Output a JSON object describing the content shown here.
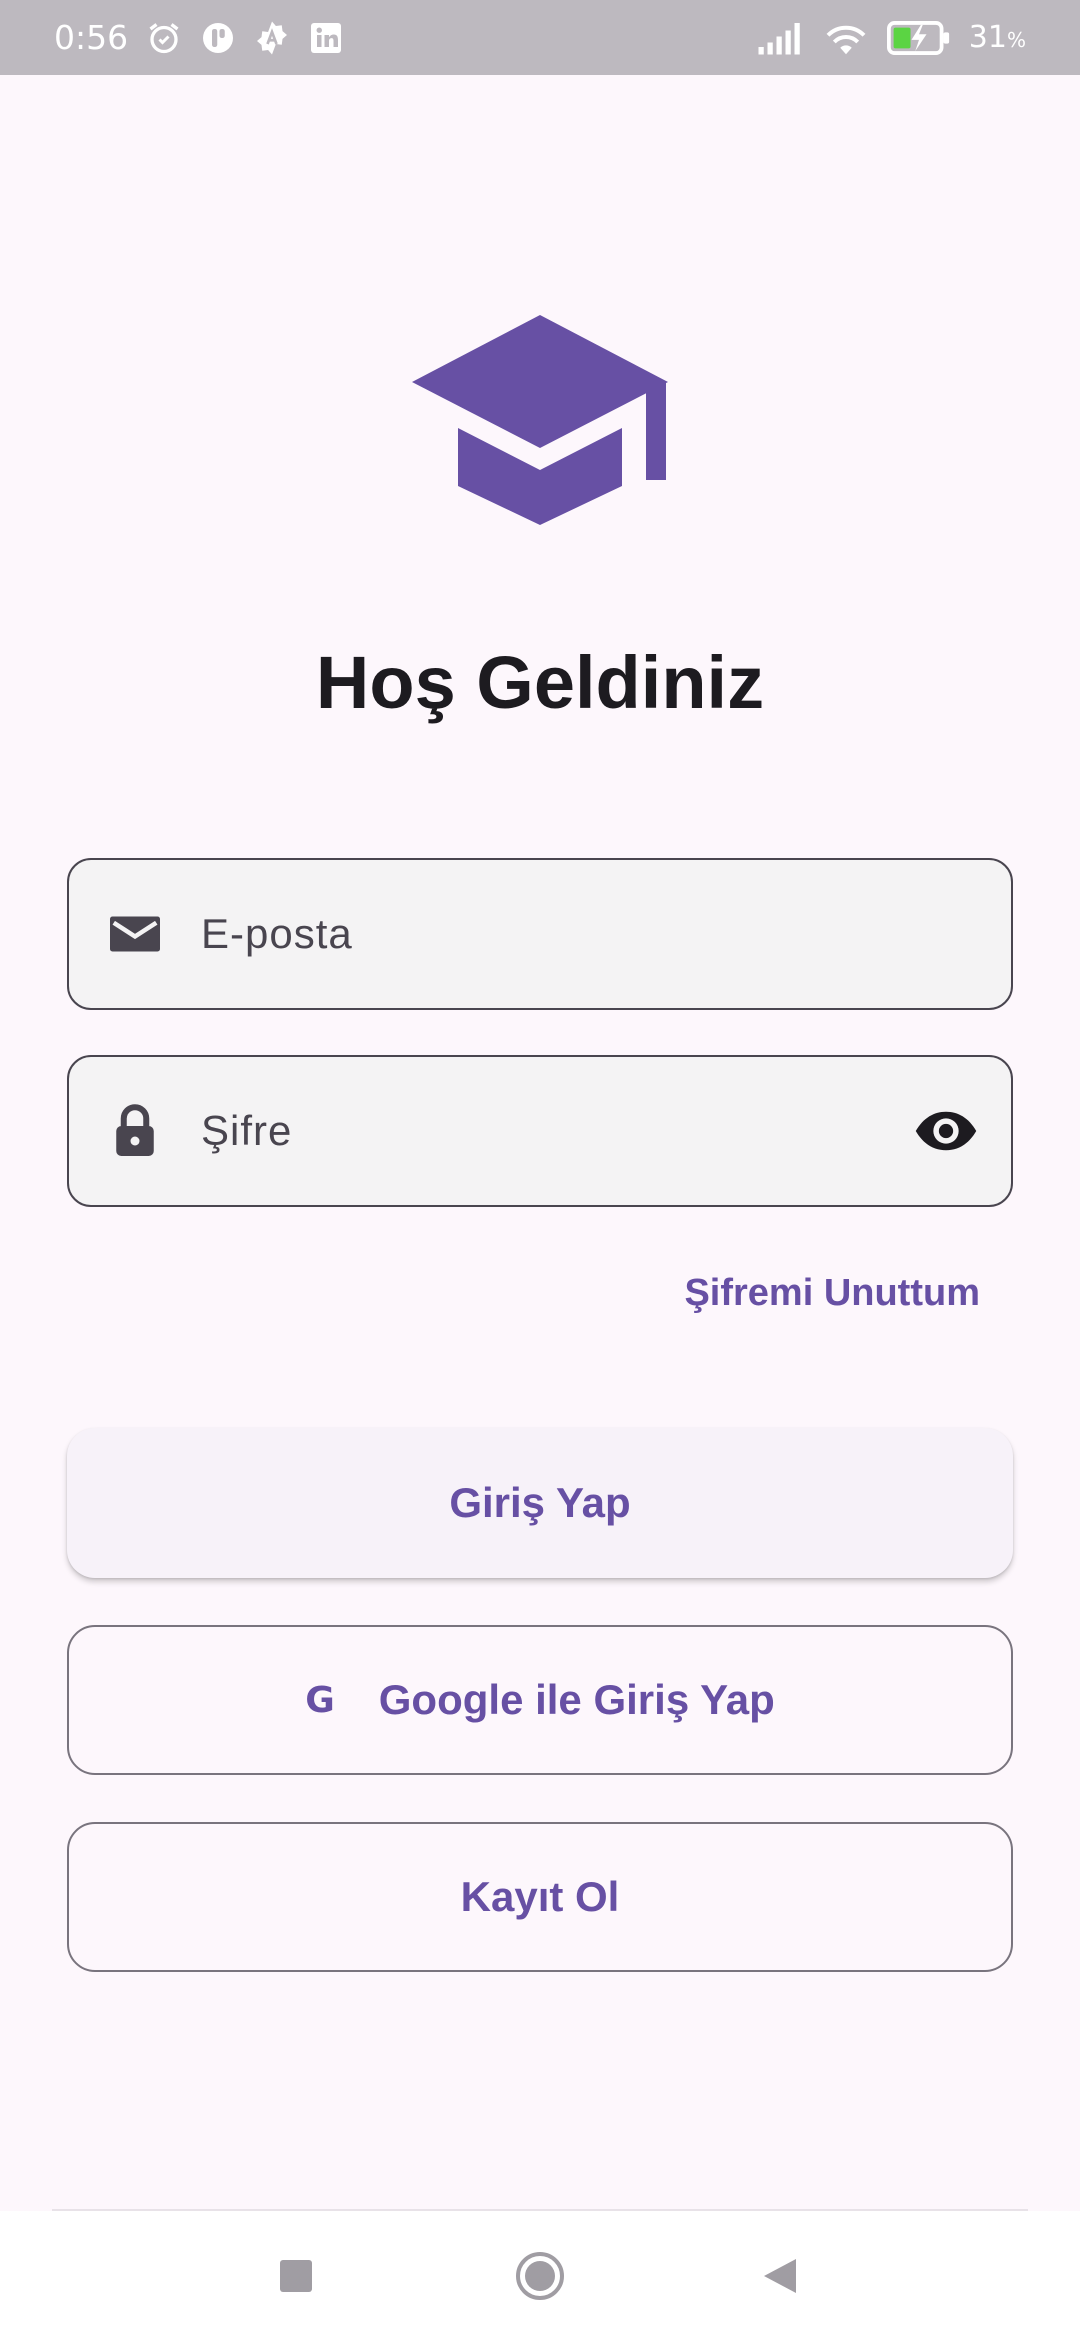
{
  "status_bar": {
    "time": "0:56",
    "battery_percent": "31",
    "battery_unit": "%",
    "icons": [
      "alarm-icon",
      "app-notification-icon",
      "gear-a-icon",
      "linkedin-icon",
      "signal-icon",
      "wifi-icon",
      "battery-charging-icon"
    ]
  },
  "app": {
    "logo_icon": "graduation-cap-icon",
    "title": "Hoş Geldiniz",
    "accent_color": "#6750a4"
  },
  "form": {
    "email_placeholder": "E-posta",
    "password_placeholder": "Şifre",
    "forgot_password": "Şifremi Unuttum"
  },
  "actions": {
    "login": "Giriş Yap",
    "google_glyph": "G",
    "google_login": "Google ile Giriş Yap",
    "register": "Kayıt Ol"
  },
  "nav_bar": {
    "icons": [
      "recents-square-icon",
      "home-circle-icon",
      "back-triangle-icon"
    ]
  }
}
